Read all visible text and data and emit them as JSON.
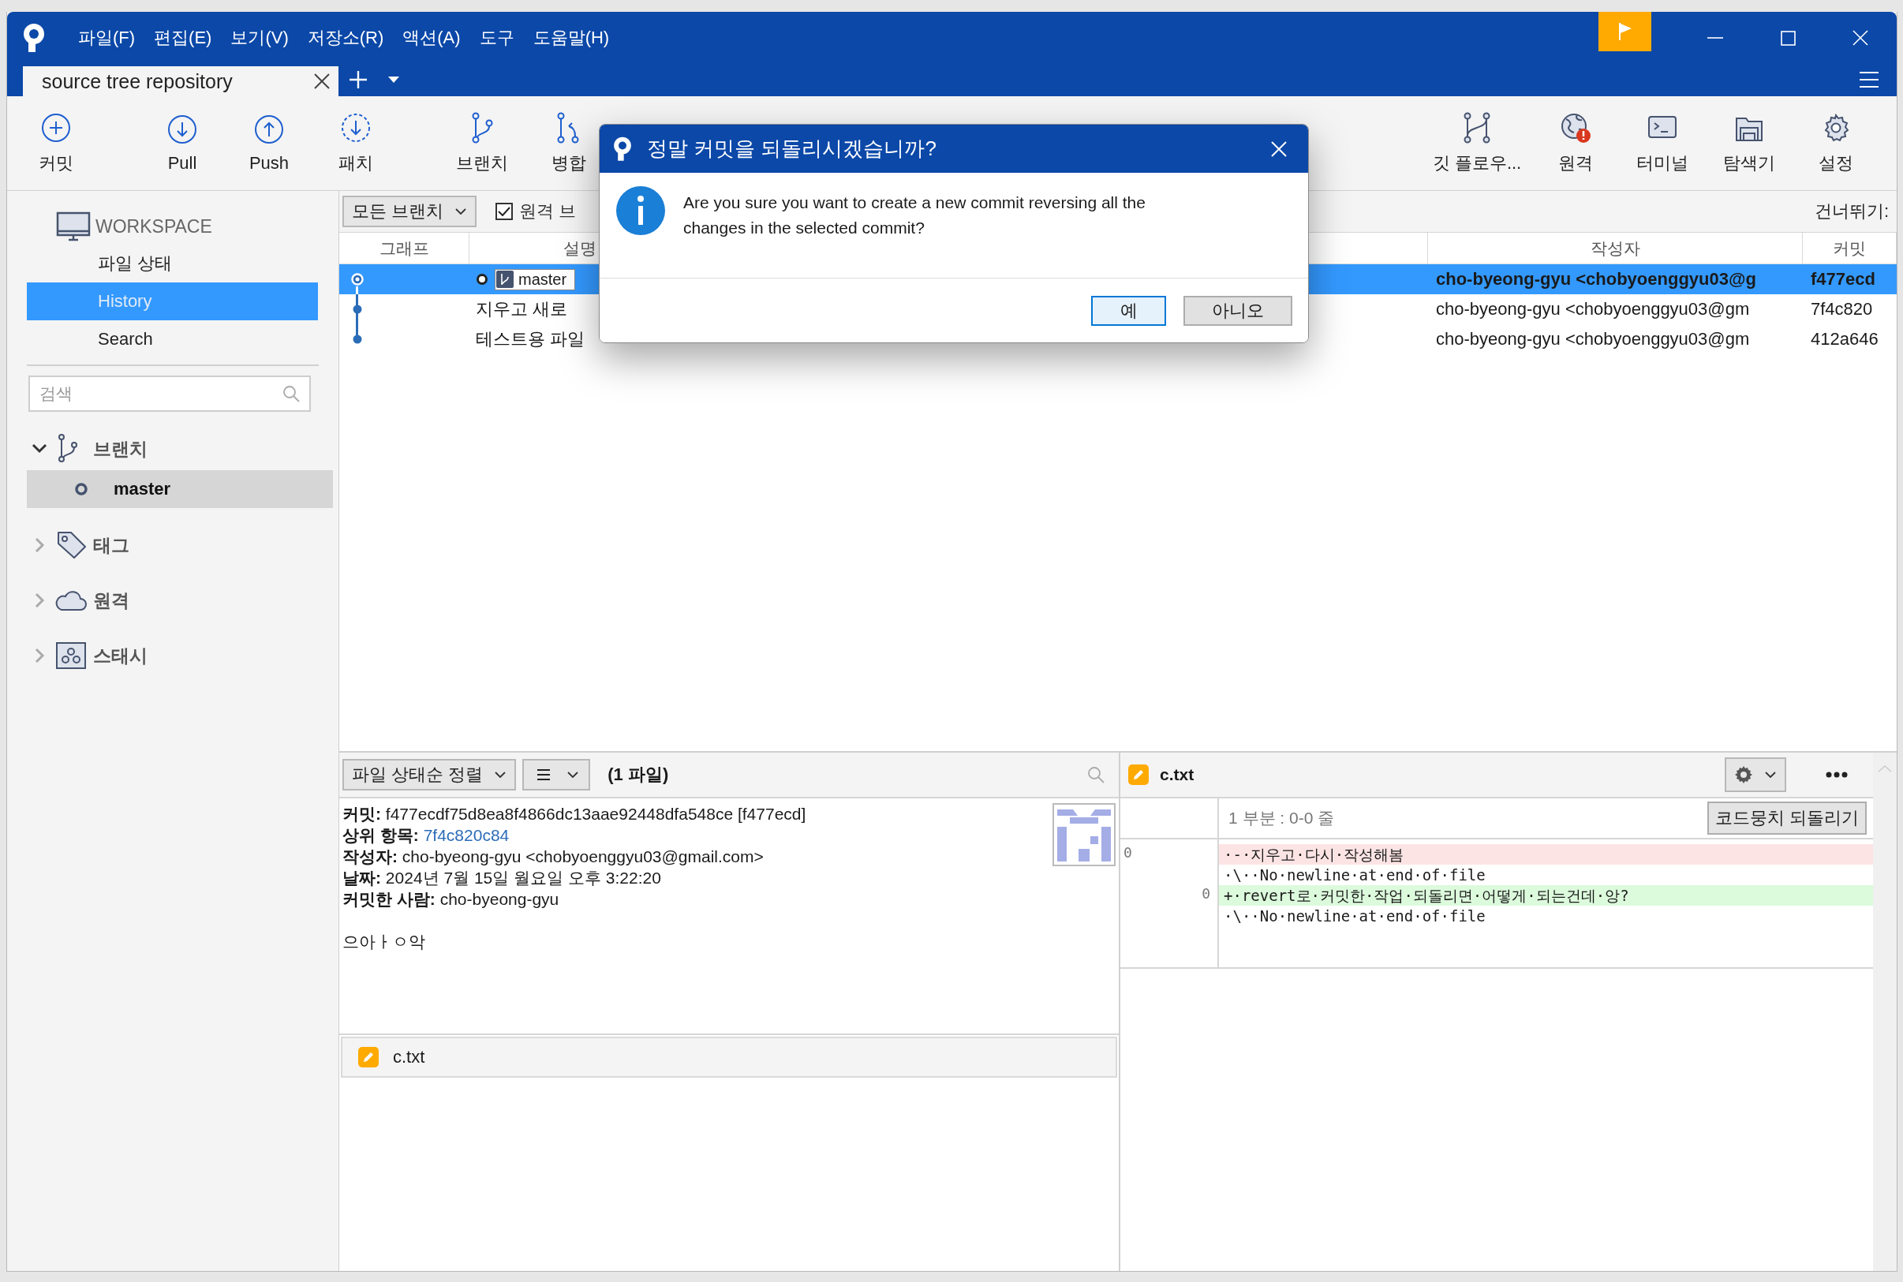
{
  "window": {
    "menu": [
      "파일(F)",
      "편집(E)",
      "보기(V)",
      "저장소(R)",
      "액션(A)",
      "도구",
      "도움말(H)"
    ],
    "tab": {
      "title": "source tree repository",
      "selected": true
    }
  },
  "toolbar": {
    "left": [
      [
        {
          "label": "커밋"
        }
      ],
      [
        {
          "label": "Pull"
        },
        {
          "label": "Push"
        },
        {
          "label": "패치"
        }
      ],
      [
        {
          "label": "브랜치"
        },
        {
          "label": "병합"
        }
      ]
    ],
    "right": [
      {
        "label": "깃 플로우..."
      },
      {
        "label": "원격"
      },
      {
        "label": "터미널"
      },
      {
        "label": "탐색기"
      },
      {
        "label": "설정"
      }
    ]
  },
  "sidebar": {
    "workspace": "WORKSPACE",
    "items": [
      {
        "label": "파일 상태",
        "selected": false
      },
      {
        "label": "History",
        "selected": true
      },
      {
        "label": "Search",
        "selected": false
      }
    ],
    "search": {
      "placeholder": "검색"
    },
    "groups": [
      {
        "label": "브랜치",
        "expanded": true,
        "children": [
          {
            "label": "master",
            "selected": true
          }
        ]
      },
      {
        "label": "태그",
        "expanded": false
      },
      {
        "label": "원격",
        "expanded": false
      },
      {
        "label": "스태시",
        "expanded": false
      }
    ]
  },
  "filter": {
    "branch": "모든 브랜치",
    "remote": {
      "label": "원격 브",
      "checked": true
    },
    "jump": "건너뛰기:"
  },
  "table": {
    "columns": [
      "그래프",
      "설명",
      "작성자",
      "커밋"
    ],
    "rows": [
      {
        "selected": true,
        "branch": "master",
        "author": "cho-byeong-gyu <chobyoenggyu03@g",
        "commit": "f477ecd"
      },
      {
        "selected": false,
        "description": "지우고 새로",
        "author": "cho-byeong-gyu <chobyoenggyu03@gm",
        "commit": "7f4c820"
      },
      {
        "selected": false,
        "description": "테스트용 파일",
        "author": "cho-byeong-gyu <chobyoenggyu03@gm",
        "commit": "412a646"
      }
    ]
  },
  "details": {
    "sort": "파일 상태순 정렬",
    "count": "(1 파일)",
    "fields": [
      {
        "label": "커밋:",
        "value": "f477ecdf75d8ea8f4866dc13aae92448dfa548ce [f477ecd]",
        "kind": "text"
      },
      {
        "label": "상위 항목:",
        "value": "7f4c820c84",
        "kind": "link"
      },
      {
        "label": "작성자:",
        "value": "cho-byeong-gyu <chobyoenggyu03@gmail.com>",
        "kind": "text"
      },
      {
        "label": "날짜:",
        "value": "2024년 7월 15일 월요일 오후 3:22:20",
        "kind": "text"
      },
      {
        "label": "커밋한 사람:",
        "value": "cho-byeong-gyu",
        "kind": "text"
      }
    ],
    "message": "으아ㅏㅇ악",
    "files": [
      {
        "name": "c.txt"
      }
    ]
  },
  "diff": {
    "file": "c.txt",
    "hunk": "1 부분 : 0-0 줄",
    "revert": "코드뭉치 되돌리기",
    "lines": [
      {
        "kind": "removed",
        "old": "0",
        "text": "·-·지우고·다시·작성해봄"
      },
      {
        "kind": "context",
        "text": "·\\··No·newline·at·end·of·file"
      },
      {
        "kind": "added",
        "new": "0",
        "text": "+·revert로·커밋한·작업·되돌리면·어떻게·되는건데·앙?"
      },
      {
        "kind": "context",
        "text": "·\\··No·newline·at·end·of·file"
      }
    ]
  },
  "dialog": {
    "title": "정말 커밋을 되돌리시겠습니까?",
    "message": "Are you sure you want to create a new commit reversing all the changes in the selected commit?",
    "buttons": [
      {
        "label": "예",
        "focused": true
      },
      {
        "label": "아니오",
        "focused": false
      }
    ]
  }
}
